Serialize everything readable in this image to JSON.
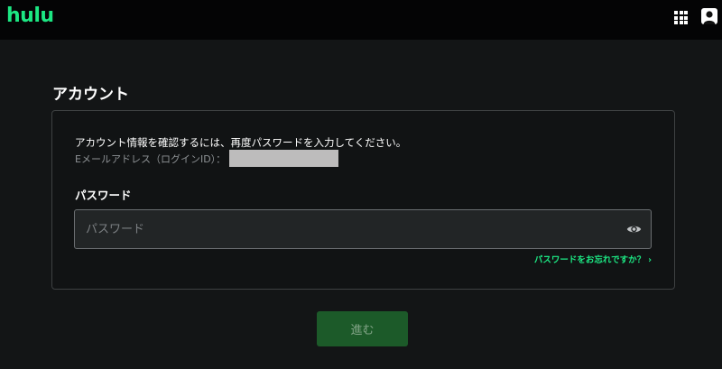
{
  "header": {
    "logo_text": "hulu",
    "apps_icon": "grid-icon",
    "profile_icon": "profile-icon"
  },
  "page": {
    "section_title": "アカウント"
  },
  "form": {
    "intro_text": "アカウント情報を確認するには、再度パスワードを入力してください。",
    "email_label": "Eメールアドレス（ログインID）：",
    "password_label": "パスワード",
    "password_placeholder": "パスワード",
    "password_value": "",
    "show_password_icon": "eye-icon",
    "forgot_link": "パスワードをお忘れですか？",
    "forgot_chevron": "›",
    "submit_label": "進む"
  },
  "colors": {
    "brand_green": "#1ce783",
    "button_bg": "#1c5a29",
    "page_bg": "#131516",
    "header_bg": "#040405"
  }
}
